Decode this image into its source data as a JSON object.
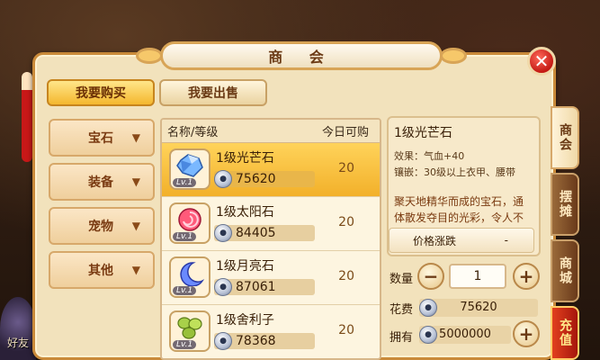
{
  "window": {
    "title": "商 会",
    "close_label": "✕"
  },
  "top_tabs": {
    "buy": "我要购买",
    "sell": "我要出售",
    "active": "buy"
  },
  "categories": [
    {
      "label": "宝石"
    },
    {
      "label": "装备"
    },
    {
      "label": "宠物"
    },
    {
      "label": "其他"
    }
  ],
  "list": {
    "header_name": "名称/等级",
    "header_qty": "今日可购",
    "items": [
      {
        "name": "1级光芒石",
        "price": "75620",
        "qty": "20",
        "level": "Lv.1",
        "icon": "blue-crystal-icon",
        "color": "#7ab8ff"
      },
      {
        "name": "1级太阳石",
        "price": "84405",
        "qty": "20",
        "level": "Lv.1",
        "icon": "red-swirl-gem-icon",
        "color": "#ff5a7a"
      },
      {
        "name": "1级月亮石",
        "price": "87061",
        "qty": "20",
        "level": "Lv.1",
        "icon": "blue-crescent-icon",
        "color": "#6a8aff"
      },
      {
        "name": "1级舍利子",
        "price": "78368",
        "qty": "20",
        "level": "Lv.1",
        "icon": "green-beads-icon",
        "color": "#a8d04a"
      }
    ]
  },
  "detail": {
    "title": "1级光芒石",
    "effect": "效果：气血+40",
    "inlay": "镶嵌：30级以上衣甲、腰带",
    "description": "聚天地精华而成的宝石，通体散发夺目的光彩，令人不敢直视。",
    "price_trend_label": "价格涨跌",
    "price_trend_value": "-"
  },
  "purchase": {
    "qty_label": "数量",
    "qty_value": "1",
    "minus": "−",
    "plus": "+",
    "cost_label": "花费",
    "cost_value": "75620",
    "own_label": "拥有",
    "own_value": "5000000"
  },
  "side_tabs": [
    {
      "label": "商会",
      "state": "active"
    },
    {
      "label": "摆摊",
      "state": "inactive"
    },
    {
      "label": "商城",
      "state": "inactive"
    },
    {
      "label": "充值",
      "state": "recharge"
    }
  ],
  "background": {
    "char_text": "好友"
  },
  "colors": {
    "accent": "#f4b72e",
    "panel": "#f2e2bc",
    "border": "#c98a3a",
    "close": "#c41a14"
  }
}
